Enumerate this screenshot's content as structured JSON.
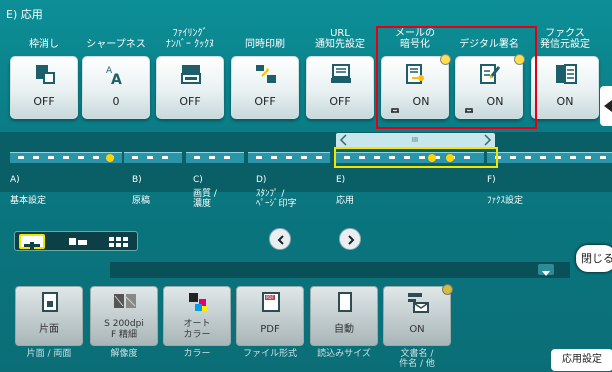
{
  "header": {
    "title": "E) 応用"
  },
  "functions": [
    {
      "label1": "",
      "label2": "枠消し",
      "value": "OFF",
      "icon": "frame-erase-icon",
      "locked": false,
      "changed": false
    },
    {
      "label1": "",
      "label2": "シャープネス",
      "value": "0",
      "icon": "sharpness-icon",
      "locked": false,
      "changed": false
    },
    {
      "label1": "ﾌｧｲﾘﾝｸﾞ",
      "label2": "ﾅﾝﾊﾞｰ ｸｯｸﾇ",
      "value": "OFF",
      "icon": "filing-number-icon",
      "locked": false,
      "changed": false
    },
    {
      "label1": "",
      "label2": "同時印刷",
      "value": "OFF",
      "icon": "simultaneous-print-icon",
      "locked": false,
      "changed": false
    },
    {
      "label1": "URL",
      "label2": "通知先設定",
      "value": "OFF",
      "icon": "url-notification-icon",
      "locked": false,
      "changed": false
    },
    {
      "label1": "メールの",
      "label2": "暗号化",
      "value": "ON",
      "icon": "email-encryption-icon",
      "locked": true,
      "changed": true
    },
    {
      "label1": "",
      "label2": "デジタル署名",
      "value": "ON",
      "icon": "digital-signature-icon",
      "locked": true,
      "changed": true
    },
    {
      "label1": "ファクス",
      "label2": "発信元設定",
      "value": "ON",
      "icon": "fax-sender-icon",
      "locked": false,
      "changed": false
    }
  ],
  "scrollbar": {
    "label": "III"
  },
  "categories": [
    {
      "letter": "A)",
      "name": "基本設定"
    },
    {
      "letter": "B)",
      "name": "原稿"
    },
    {
      "letter": "C)",
      "name": "画質 /\n濃度"
    },
    {
      "letter": "D)",
      "name": "ｽﾀﾝﾌﾟ /\nﾍﾟｰｼﾞ印字"
    },
    {
      "letter": "E)",
      "name": "応用"
    },
    {
      "letter": "F)",
      "name": "ﾌｧｸｽ設定"
    }
  ],
  "close_label": "閉じる",
  "quick_settings": [
    {
      "value": "片面",
      "label": "片面 / 両面",
      "icon": "simplex-icon",
      "changed": false
    },
    {
      "value": "S 200dpi\nF 精細",
      "label": "解像度",
      "icon": "resolution-icon",
      "changed": false
    },
    {
      "value": "オート\nカラー",
      "label": "カラー",
      "icon": "color-icon",
      "changed": false
    },
    {
      "value": "PDF",
      "label": "ファイル形式",
      "icon": "pdf-file-icon",
      "changed": false
    },
    {
      "value": "自動",
      "label": "読込みサイズ",
      "icon": "scan-size-icon",
      "changed": false
    },
    {
      "value": "ON",
      "label": "文書名 /\n件名 / 他",
      "icon": "document-name-icon",
      "changed": true
    }
  ],
  "applied_button": "応用設定",
  "colors": {
    "accent_yellow": "#f2e600",
    "highlight_red": "#e30016",
    "background_teal": "#0a7780"
  }
}
